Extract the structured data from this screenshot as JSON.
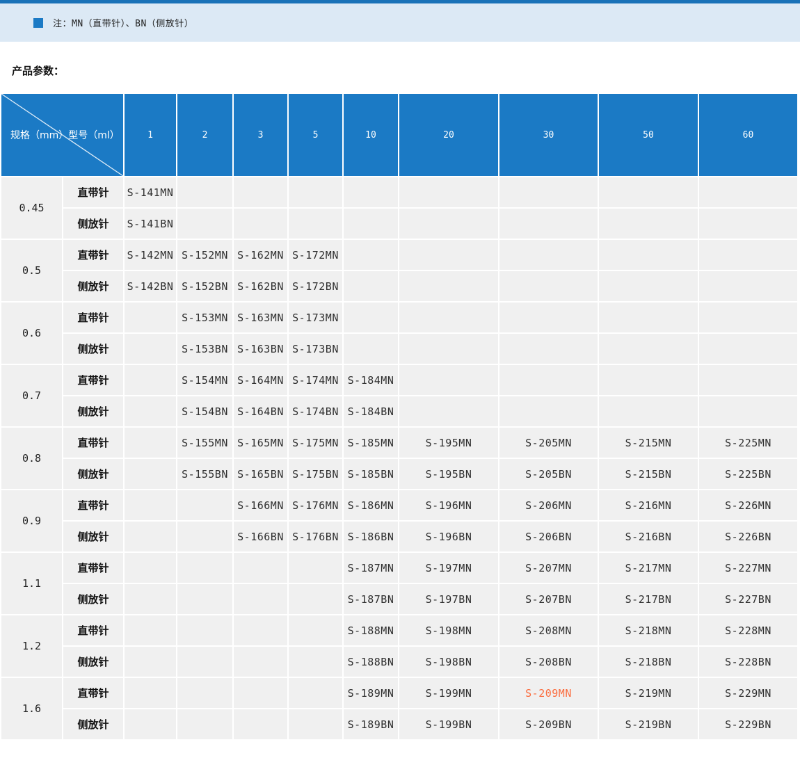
{
  "note_banner": {
    "text": "注：MN（直带针）、BN（侧放针）",
    "bullet_icon": "square-bullet-icon"
  },
  "section_title": "产品参数：",
  "colors": {
    "top_bar": "#1a72b8",
    "banner_bg": "#dce9f5",
    "accent_blue": "#1b7ac5",
    "cell_bg": "#f0f0f0",
    "highlight_orange": "#fb6c3e"
  },
  "table": {
    "corner": {
      "spec_label": "规格（mm）",
      "model_label": "型号（ml）"
    },
    "columns": [
      "1",
      "2",
      "3",
      "5",
      "10",
      "20",
      "30",
      "50",
      "60"
    ],
    "row_type_labels": [
      "直带针",
      "侧放针"
    ],
    "groups": [
      {
        "spec": "0.45",
        "mn": [
          "S-141MN",
          "",
          "",
          "",
          "",
          "",
          "",
          "",
          ""
        ],
        "bn": [
          "S-141BN",
          "",
          "",
          "",
          "",
          "",
          "",
          "",
          ""
        ]
      },
      {
        "spec": "0.5",
        "mn": [
          "S-142MN",
          "S-152MN",
          "S-162MN",
          "S-172MN",
          "",
          "",
          "",
          "",
          ""
        ],
        "bn": [
          "S-142BN",
          "S-152BN",
          "S-162BN",
          "S-172BN",
          "",
          "",
          "",
          "",
          ""
        ]
      },
      {
        "spec": "0.6",
        "mn": [
          "",
          "S-153MN",
          "S-163MN",
          "S-173MN",
          "",
          "",
          "",
          "",
          ""
        ],
        "bn": [
          "",
          "S-153BN",
          "S-163BN",
          "S-173BN",
          "",
          "",
          "",
          "",
          ""
        ]
      },
      {
        "spec": "0.7",
        "mn": [
          "",
          "S-154MN",
          "S-164MN",
          "S-174MN",
          "S-184MN",
          "",
          "",
          "",
          ""
        ],
        "bn": [
          "",
          "S-154BN",
          "S-164BN",
          "S-174BN",
          "S-184BN",
          "",
          "",
          "",
          ""
        ]
      },
      {
        "spec": "0.8",
        "mn": [
          "",
          "S-155MN",
          "S-165MN",
          "S-175MN",
          "S-185MN",
          "S-195MN",
          "S-205MN",
          "S-215MN",
          "S-225MN"
        ],
        "bn": [
          "",
          "S-155BN",
          "S-165BN",
          "S-175BN",
          "S-185BN",
          "S-195BN",
          "S-205BN",
          "S-215BN",
          "S-225BN"
        ]
      },
      {
        "spec": "0.9",
        "mn": [
          "",
          "",
          "S-166MN",
          "S-176MN",
          "S-186MN",
          "S-196MN",
          "S-206MN",
          "S-216MN",
          "S-226MN"
        ],
        "bn": [
          "",
          "",
          "S-166BN",
          "S-176BN",
          "S-186BN",
          "S-196BN",
          "S-206BN",
          "S-216BN",
          "S-226BN"
        ]
      },
      {
        "spec": "1.1",
        "mn": [
          "",
          "",
          "",
          "",
          "S-187MN",
          "S-197MN",
          "S-207MN",
          "S-217MN",
          "S-227MN"
        ],
        "bn": [
          "",
          "",
          "",
          "",
          "S-187BN",
          "S-197BN",
          "S-207BN",
          "S-217BN",
          "S-227BN"
        ]
      },
      {
        "spec": "1.2",
        "mn": [
          "",
          "",
          "",
          "",
          "S-188MN",
          "S-198MN",
          "S-208MN",
          "S-218MN",
          "S-228MN"
        ],
        "bn": [
          "",
          "",
          "",
          "",
          "S-188BN",
          "S-198BN",
          "S-208BN",
          "S-218BN",
          "S-228BN"
        ]
      },
      {
        "spec": "1.6",
        "mn": [
          "",
          "",
          "",
          "",
          "S-189MN",
          "S-199MN",
          "S-209MN",
          "S-219MN",
          "S-229MN"
        ],
        "bn": [
          "",
          "",
          "",
          "",
          "S-189BN",
          "S-199BN",
          "S-209BN",
          "S-219BN",
          "S-229BN"
        ]
      }
    ],
    "highlight": {
      "group_index": 8,
      "row": "mn",
      "col_index": 6,
      "value": "S-209MN",
      "color": "#fb6c3e"
    }
  }
}
